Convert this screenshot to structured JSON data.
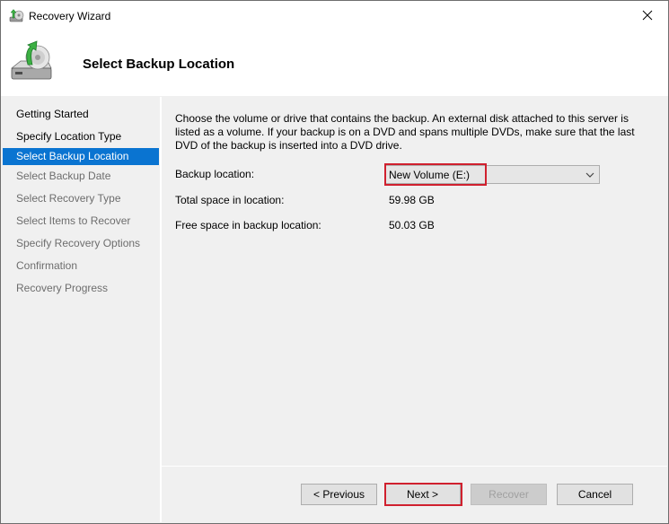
{
  "window": {
    "title": "Recovery Wizard",
    "icon": "recovery-wizard-icon",
    "close_icon": "close-icon"
  },
  "header": {
    "title": "Select Backup Location",
    "icon": "backup-drive-recover-icon"
  },
  "steps": [
    {
      "label": "Getting Started",
      "state": "done"
    },
    {
      "label": "Specify Location Type",
      "state": "done"
    },
    {
      "label": "Select Backup Location",
      "state": "active"
    },
    {
      "label": "Select Backup Date",
      "state": "pending"
    },
    {
      "label": "Select Recovery Type",
      "state": "pending"
    },
    {
      "label": "Select Items to Recover",
      "state": "pending"
    },
    {
      "label": "Specify Recovery Options",
      "state": "pending"
    },
    {
      "label": "Confirmation",
      "state": "pending"
    },
    {
      "label": "Recovery Progress",
      "state": "pending"
    }
  ],
  "content": {
    "description": "Choose the volume or drive that contains the backup. An external disk attached to this server is listed as a volume. If your backup is on a DVD and spans multiple DVDs, make sure that the last DVD of the backup is inserted into a DVD drive.",
    "backup_location_label": "Backup location:",
    "backup_location_value": "New Volume (E:)",
    "total_space_label": "Total space in location:",
    "total_space_value": "59.98 GB",
    "free_space_label": "Free space in backup location:",
    "free_space_value": "50.03 GB"
  },
  "buttons": {
    "previous": "< Previous",
    "next": "Next >",
    "recover": "Recover",
    "cancel": "Cancel"
  },
  "colors": {
    "active_step": "#0a74d1",
    "highlight": "#d0202e"
  }
}
